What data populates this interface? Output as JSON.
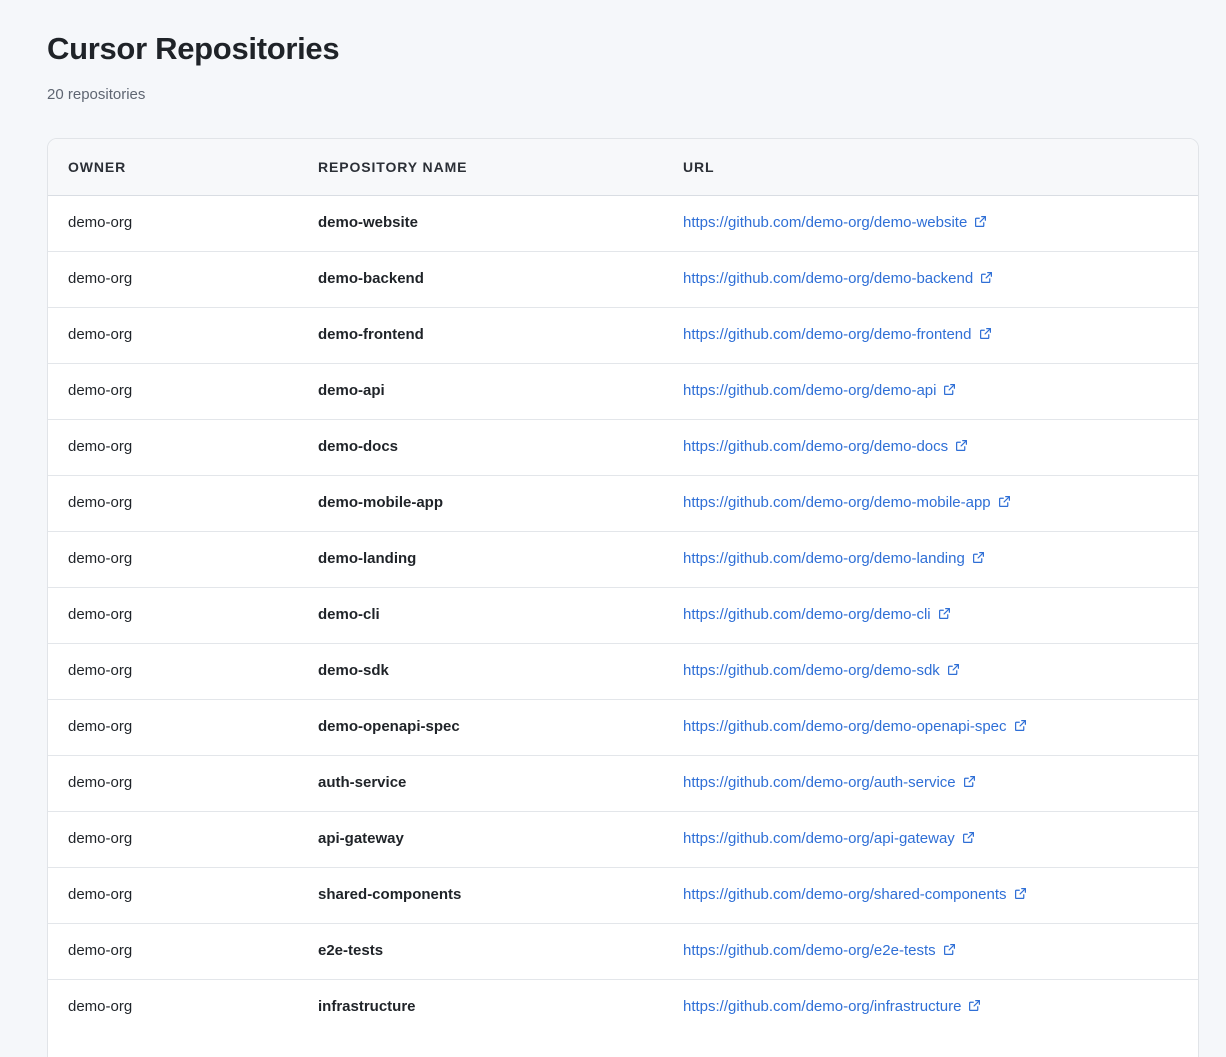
{
  "page": {
    "title": "Cursor Repositories",
    "count_label": "20 repositories"
  },
  "table": {
    "columns": [
      "OWNER",
      "REPOSITORY NAME",
      "URL"
    ],
    "rows": [
      {
        "owner": "demo-org",
        "name": "demo-website",
        "url": "https://github.com/demo-org/demo-website"
      },
      {
        "owner": "demo-org",
        "name": "demo-backend",
        "url": "https://github.com/demo-org/demo-backend"
      },
      {
        "owner": "demo-org",
        "name": "demo-frontend",
        "url": "https://github.com/demo-org/demo-frontend"
      },
      {
        "owner": "demo-org",
        "name": "demo-api",
        "url": "https://github.com/demo-org/demo-api"
      },
      {
        "owner": "demo-org",
        "name": "demo-docs",
        "url": "https://github.com/demo-org/demo-docs"
      },
      {
        "owner": "demo-org",
        "name": "demo-mobile-app",
        "url": "https://github.com/demo-org/demo-mobile-app"
      },
      {
        "owner": "demo-org",
        "name": "demo-landing",
        "url": "https://github.com/demo-org/demo-landing"
      },
      {
        "owner": "demo-org",
        "name": "demo-cli",
        "url": "https://github.com/demo-org/demo-cli"
      },
      {
        "owner": "demo-org",
        "name": "demo-sdk",
        "url": "https://github.com/demo-org/demo-sdk"
      },
      {
        "owner": "demo-org",
        "name": "demo-openapi-spec",
        "url": "https://github.com/demo-org/demo-openapi-spec"
      },
      {
        "owner": "demo-org",
        "name": "auth-service",
        "url": "https://github.com/demo-org/auth-service"
      },
      {
        "owner": "demo-org",
        "name": "api-gateway",
        "url": "https://github.com/demo-org/api-gateway"
      },
      {
        "owner": "demo-org",
        "name": "shared-components",
        "url": "https://github.com/demo-org/shared-components"
      },
      {
        "owner": "demo-org",
        "name": "e2e-tests",
        "url": "https://github.com/demo-org/e2e-tests"
      },
      {
        "owner": "demo-org",
        "name": "infrastructure",
        "url": "https://github.com/demo-org/infrastructure"
      }
    ]
  },
  "icons": {
    "link_icon": "external-link-icon"
  },
  "colors": {
    "background": "#f5f7fa",
    "link": "#2f6fd6",
    "text": "#1f2328",
    "muted": "#5f6672"
  }
}
